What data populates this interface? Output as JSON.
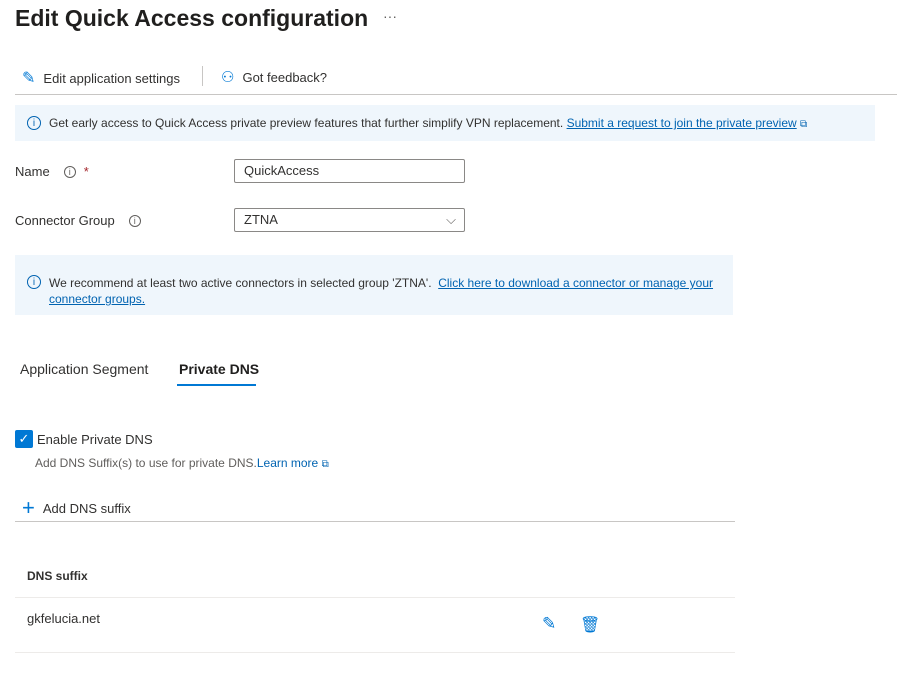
{
  "title": "Edit Quick Access configuration",
  "more": "···",
  "toolbar": {
    "edit": "Edit application settings",
    "feedback": "Got feedback?"
  },
  "banner": {
    "text": "Get early access to Quick Access private preview features that further simplify VPN replacement.",
    "link": "Submit a request to join the private preview"
  },
  "form": {
    "name_label": "Name",
    "required": "*",
    "name_value": "QuickAccess",
    "group_label": "Connector Group",
    "group_value": "ZTNA"
  },
  "connector_info": {
    "text": "We recommend at least two active connectors in selected group 'ZTNA'.",
    "link": "Click here to download a connector or manage your connector groups."
  },
  "tabs": [
    {
      "label": "Application Segment"
    },
    {
      "label": "Private DNS",
      "active": true
    }
  ],
  "dns": {
    "enable_label": "Enable Private DNS",
    "enabled": true,
    "help": "Add DNS Suffix(s) to use for private DNS.",
    "learn_more": "Learn more",
    "add": "Add DNS suffix",
    "column": "DNS suffix",
    "rows": [
      {
        "suffix": "gkfelucia.net"
      }
    ]
  },
  "colors": {
    "accent": "#0078d4",
    "info_bg": "#eff6fc"
  }
}
